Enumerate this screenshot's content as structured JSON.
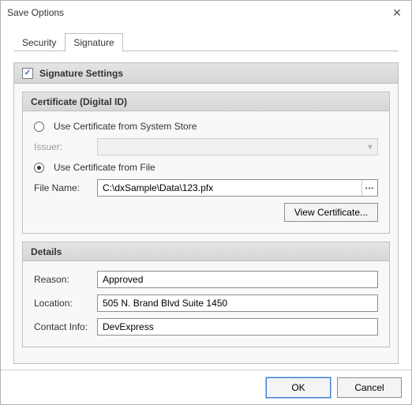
{
  "window": {
    "title": "Save Options"
  },
  "tabs": {
    "security": "Security",
    "signature": "Signature",
    "active": "signature"
  },
  "signature": {
    "settings_label": "Signature Settings",
    "settings_enabled": true,
    "certificate": {
      "group_title": "Certificate (Digital ID)",
      "option_system": {
        "label": "Use Certificate from System Store",
        "selected": false
      },
      "issuer_label": "Issuer:",
      "issuer_value": "",
      "option_file": {
        "label": "Use Certificate from File",
        "selected": true
      },
      "filename_label": "File Name:",
      "filename_value": "C:\\dxSample\\Data\\123.pfx",
      "view_button": "View Certificate..."
    },
    "details": {
      "group_title": "Details",
      "reason_label": "Reason:",
      "reason_value": "Approved",
      "location_label": "Location:",
      "location_value": "505 N. Brand Blvd Suite 1450",
      "contact_label": "Contact Info:",
      "contact_value": "DevExpress"
    }
  },
  "footer": {
    "ok": "OK",
    "cancel": "Cancel"
  }
}
